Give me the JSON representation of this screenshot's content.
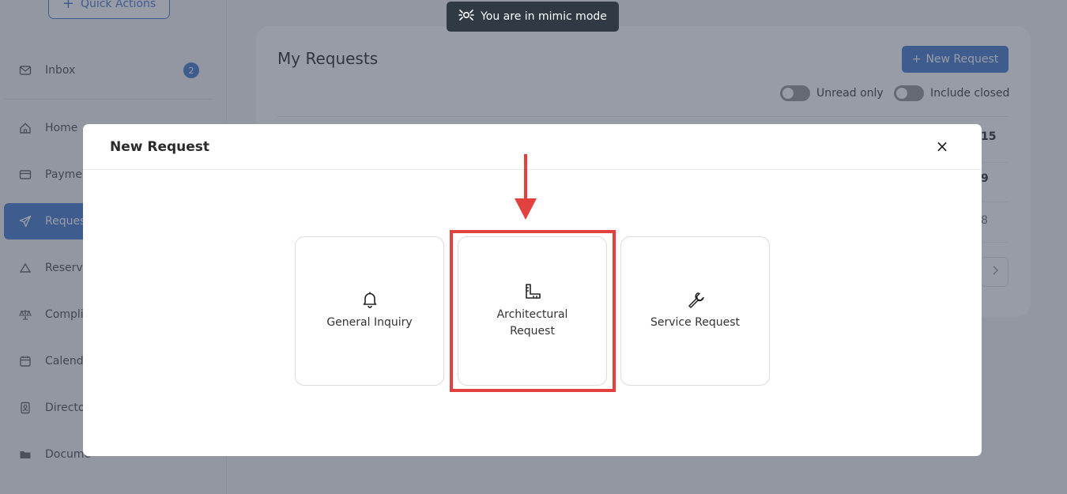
{
  "mimic_banner": {
    "text": "You are in mimic mode",
    "icon": "mimic-icon"
  },
  "sidebar": {
    "quick_actions": "Quick Actions",
    "items": [
      {
        "label": "Inbox",
        "icon": "mail-icon",
        "badge": "2"
      },
      {
        "label": "Home",
        "icon": "home-icon"
      },
      {
        "label": "Payme",
        "icon": "card-icon"
      },
      {
        "label": "Reques",
        "icon": "send-icon",
        "active": true
      },
      {
        "label": "Reserv",
        "icon": "reserve-icon"
      },
      {
        "label": "Compli",
        "icon": "scale-icon"
      },
      {
        "label": "Calend",
        "icon": "calendar-icon"
      },
      {
        "label": "Directo",
        "icon": "contact-icon"
      },
      {
        "label": "Docume",
        "icon": "folder-icon"
      }
    ]
  },
  "main": {
    "title": "My Requests",
    "new_request_button": "New Request",
    "toggles": [
      {
        "label": "Unread only",
        "on": false
      },
      {
        "label": "Include closed",
        "on": false
      }
    ],
    "visible_numbers": [
      "15",
      "9",
      "8"
    ]
  },
  "modal": {
    "title": "New Request",
    "close": "×",
    "options": [
      {
        "label": "General Inquiry",
        "icon": "bell-icon"
      },
      {
        "label": "Architectural Request",
        "icon": "ruler-icon",
        "highlighted": true
      },
      {
        "label": "Service Request",
        "icon": "wrench-icon"
      }
    ]
  },
  "colors": {
    "accent": "#4c7fd1",
    "highlight": "#e34040",
    "banner": "#2f3a44"
  }
}
